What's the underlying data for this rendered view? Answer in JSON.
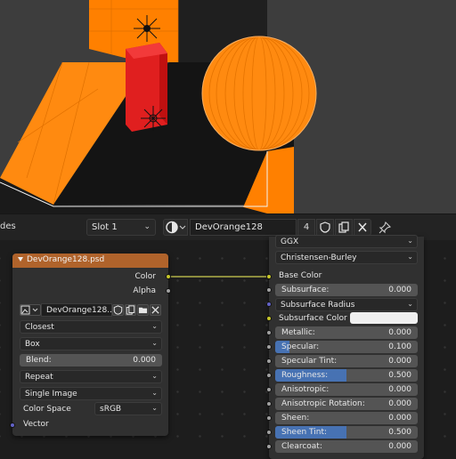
{
  "header": {
    "left_label": "des",
    "slot_label": "Slot 1",
    "material_name": "DevOrange128",
    "user_count": "4",
    "icons": [
      "material-sphere-icon",
      "fake-user-shield-icon",
      "duplicate-icon",
      "unlink-x-icon",
      "pin-icon"
    ]
  },
  "image_node": {
    "title": "DevOrange128.psd",
    "outputs": [
      "Color",
      "Alpha"
    ],
    "image_name": "DevOrange128...",
    "interpolation": "Closest",
    "projection": "Box",
    "blend_label": "Blend:",
    "blend_value": "0.000",
    "extension": "Repeat",
    "source": "Single Image",
    "color_space_label": "Color Space",
    "color_space": "sRGB",
    "input_label": "Vector"
  },
  "bsdf_node": {
    "distribution": "GGX",
    "subsurface_method": "Christensen-Burley",
    "base_color_label": "Base Color",
    "rows": [
      {
        "label": "Subsurface:",
        "value": "0.000",
        "fill": 0.0
      },
      {
        "label": "Subsurface Radius",
        "value": "",
        "fill": 0.0
      },
      {
        "label": "Subsurface Color",
        "value": "",
        "fill": 0.0
      },
      {
        "label": "Metallic:",
        "value": "0.000",
        "fill": 0.0
      },
      {
        "label": "Specular:",
        "value": "0.100",
        "fill": 0.1
      },
      {
        "label": "Specular Tint:",
        "value": "0.000",
        "fill": 0.0
      },
      {
        "label": "Roughness:",
        "value": "0.500",
        "fill": 0.5
      },
      {
        "label": "Anisotropic:",
        "value": "0.000",
        "fill": 0.0
      },
      {
        "label": "Anisotropic Rotation:",
        "value": "0.000",
        "fill": 0.0
      },
      {
        "label": "Sheen:",
        "value": "0.000",
        "fill": 0.0
      },
      {
        "label": "Sheen Tint:",
        "value": "0.500",
        "fill": 0.5
      },
      {
        "label": "Clearcoat:",
        "value": "0.000",
        "fill": 0.0
      }
    ]
  },
  "colors": {
    "node_header": "#b0632b",
    "slider_fill": "#4772b3",
    "orange": "#ff8000",
    "red_box": "#e01f1f"
  }
}
